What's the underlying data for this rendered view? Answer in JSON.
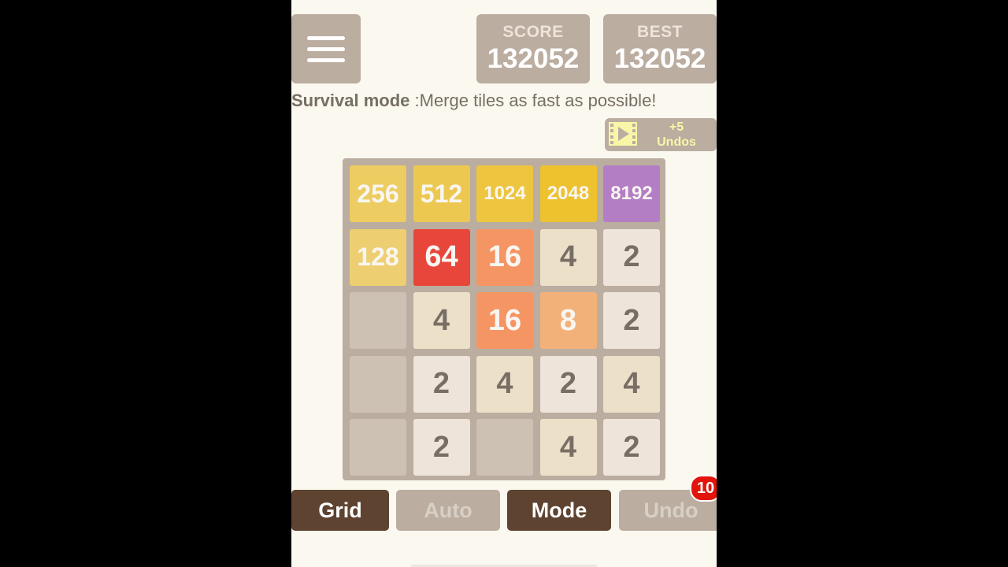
{
  "header": {
    "score_label": "SCORE",
    "score_value": "132052",
    "best_label": "BEST",
    "best_value": "132052"
  },
  "tagline": {
    "mode": "Survival mode",
    "text": " :Merge tiles as fast as possible!"
  },
  "undos": {
    "count": "+5",
    "label": "Undos"
  },
  "board": {
    "rows": [
      [
        "256",
        "512",
        "1024",
        "2048",
        "8192"
      ],
      [
        "128",
        "64",
        "16",
        "4",
        "2"
      ],
      [
        "",
        "4",
        "16",
        "8",
        "2"
      ],
      [
        "",
        "2",
        "4",
        "2",
        "4"
      ],
      [
        "",
        "2",
        "",
        "4",
        "2"
      ]
    ]
  },
  "tile_colors": {
    "empty": "#cdc1b4",
    "2": "#eee4da",
    "4": "#ede0c8",
    "8": "#f2b179",
    "16": "#f59563",
    "64": "#e8463a",
    "128": "#edcf72",
    "256": "#edcc61",
    "512": "#edc850",
    "1024": "#edc53f",
    "2048": "#edc22e",
    "8192": "#b47ec4"
  },
  "buttons": {
    "grid": "Grid",
    "auto": "Auto",
    "mode": "Mode",
    "undo": "Undo",
    "undo_badge": "10"
  }
}
